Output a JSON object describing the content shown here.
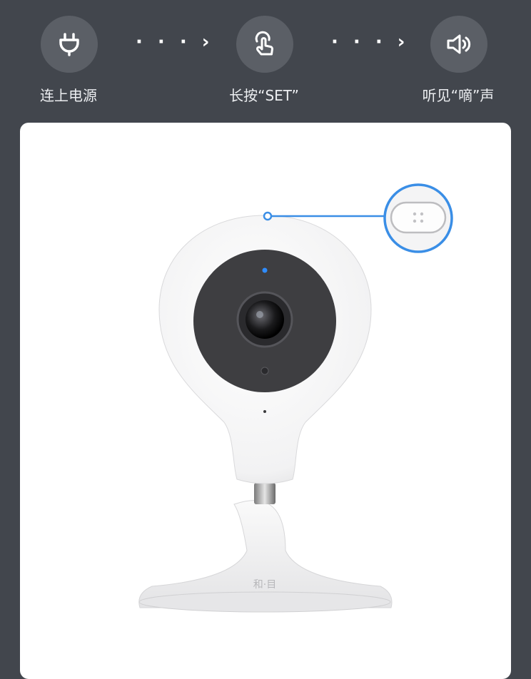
{
  "steps": [
    {
      "label": "连上电源",
      "icon": "plug-icon"
    },
    {
      "label": "长按“SET”",
      "icon": "press-finger-icon"
    },
    {
      "label": "听见“嘀”声",
      "icon": "speaker-icon"
    }
  ],
  "arrow": "· · · ›",
  "illustration": {
    "product": "smart-camera",
    "base_logo_text": "和·目",
    "highlight_color": "#3a8ee6"
  }
}
